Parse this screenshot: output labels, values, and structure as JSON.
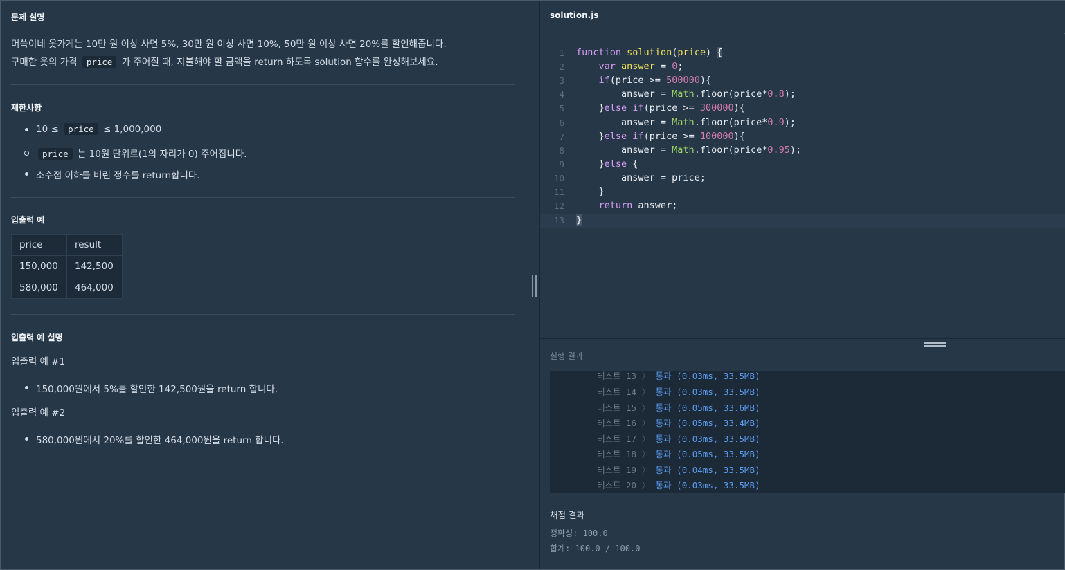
{
  "problem": {
    "desc_title": "문제 설명",
    "desc_line1": "머쓱이네 옷가게는 10만 원 이상 사면 5%, 30만 원 이상 사면 10%, 50만 원 이상 사면 20%를 할인해줍니다.",
    "desc_line2_pre": "구매한 옷의 가격",
    "desc_line2_code": "price",
    "desc_line2_post": "가 주어질 때, 지불해야 할 금액을 return 하도록 solution 함수를 완성해보세요.",
    "constraints_title": "제한사항",
    "c1_pre": "10 ≤",
    "c1_code": "price",
    "c1_post": "≤ 1,000,000",
    "c2_code": "price",
    "c2_post": "는 10원 단위로(1의 자리가 0) 주어집니다.",
    "c3": "소수점 이하를 버린 정수를 return합니다.",
    "io_title": "입출력 예",
    "io_table": {
      "headers": [
        "price",
        "result"
      ],
      "rows": [
        [
          "150,000",
          "142,500"
        ],
        [
          "580,000",
          "464,000"
        ]
      ]
    },
    "io_exp_title": "입출력 예 설명",
    "ex1_title": "입출력 예 #1",
    "ex1_text": "150,000원에서 5%를 할인한 142,500원을 return 합니다.",
    "ex2_title": "입출력 예 #2",
    "ex2_text": "580,000원에서 20%를 할인한 464,000원을 return 합니다."
  },
  "editor": {
    "filename": "solution.js",
    "line_numbers": [
      "1",
      "2",
      "3",
      "4",
      "5",
      "6",
      "7",
      "8",
      "9",
      "10",
      "11",
      "12",
      "13"
    ]
  },
  "run": {
    "label": "실행 결과",
    "results": [
      {
        "name": "테스트 13",
        "sep": "〉",
        "value": "통과 (0.03ms, 33.5MB)"
      },
      {
        "name": "테스트 14",
        "sep": "〉",
        "value": "통과 (0.03ms, 33.5MB)"
      },
      {
        "name": "테스트 15",
        "sep": "〉",
        "value": "통과 (0.05ms, 33.6MB)"
      },
      {
        "name": "테스트 16",
        "sep": "〉",
        "value": "통과 (0.05ms, 33.4MB)"
      },
      {
        "name": "테스트 17",
        "sep": "〉",
        "value": "통과 (0.03ms, 33.5MB)"
      },
      {
        "name": "테스트 18",
        "sep": "〉",
        "value": "통과 (0.05ms, 33.5MB)"
      },
      {
        "name": "테스트 19",
        "sep": "〉",
        "value": "통과 (0.04ms, 33.5MB)"
      },
      {
        "name": "테스트 20",
        "sep": "〉",
        "value": "통과 (0.03ms, 33.5MB)"
      }
    ]
  },
  "score": {
    "title": "채점 결과",
    "accuracy": "정확성: 100.0",
    "total": "합계: 100.0 / 100.0"
  }
}
